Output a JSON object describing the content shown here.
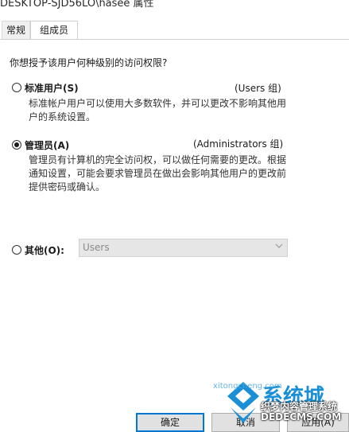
{
  "window": {
    "title": "DESKTOP-SJD56LO\\hasee 属性"
  },
  "tabs": [
    {
      "label": "常规"
    },
    {
      "label": "组成员"
    }
  ],
  "panel": {
    "question": "你想授予该用户何种级别的访问权限?",
    "options": [
      {
        "label": "标准用户(S)",
        "group": "(Users 组)",
        "desc_lines": [
          "标准帐户用户可以使用大多数软件，并可以更改不影响其他用",
          "户的系统设置。"
        ],
        "checked": false
      },
      {
        "label": "管理员(A)",
        "group": "(Administrators 组)",
        "desc_lines": [
          "管理员有计算机的完全访问权，可以做任何需要的更改。根据",
          "通知设置，可能会要求管理员在做出会影响其他用户的更改前",
          "提供密码或确认。"
        ],
        "checked": true
      }
    ],
    "other": {
      "label": "其他(O):",
      "select_value": "Users",
      "checked": false
    }
  },
  "buttons": {
    "ok": "确定",
    "cancel": "取消",
    "apply": "应用(A)"
  },
  "watermark": {
    "line1": "系统城",
    "line2": "xitongcheng.com",
    "line3": "织梦内容管理系统",
    "line4": "DEDECMS.COM"
  },
  "colors": {
    "accent": "#0078d7",
    "watermark_blue": "#1a8fd6"
  }
}
